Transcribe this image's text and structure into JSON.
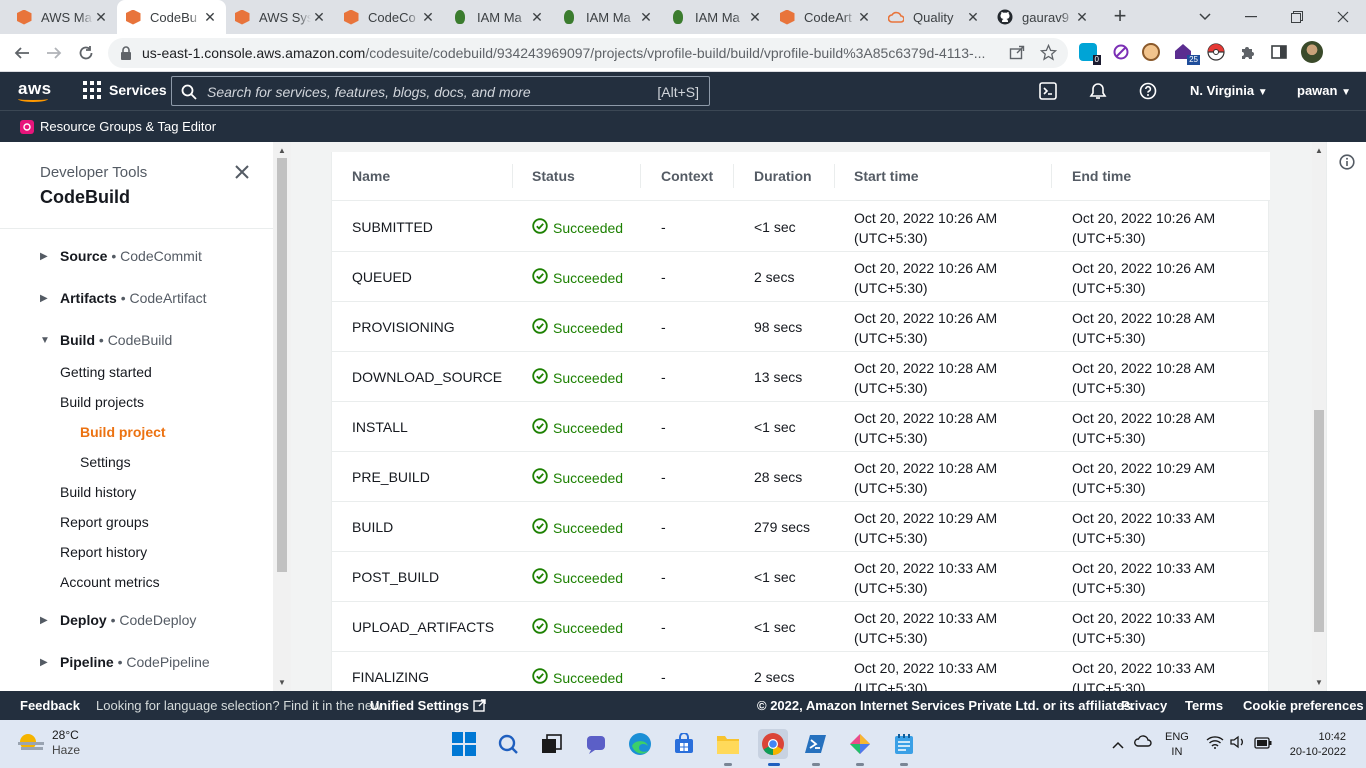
{
  "browser": {
    "tabs": [
      {
        "title": "AWS Ma",
        "icon": "aws-cube-icon",
        "active": false
      },
      {
        "title": "CodeBu",
        "icon": "aws-cube-icon",
        "active": true
      },
      {
        "title": "AWS Sys",
        "icon": "aws-cube-icon",
        "active": false
      },
      {
        "title": "CodeCo",
        "icon": "aws-cube-icon",
        "active": false
      },
      {
        "title": "IAM Ma",
        "icon": "iam-icon",
        "active": false
      },
      {
        "title": "IAM Ma",
        "icon": "iam-icon",
        "active": false
      },
      {
        "title": "IAM Ma",
        "icon": "iam-icon",
        "active": false
      },
      {
        "title": "CodeArt",
        "icon": "aws-cube-icon",
        "active": false
      },
      {
        "title": "Quality",
        "icon": "quality-icon",
        "active": false
      },
      {
        "title": "gaurav9",
        "icon": "github-icon",
        "active": false
      }
    ],
    "url_main": "us-east-1.console.aws.amazon.com",
    "url_path": "/codesuite/codebuild/934243969097/projects/vprofile-build/build/vprofile-build%3A85c6379d-4113-...",
    "ext_badges": {
      "first": "0",
      "second": "25"
    }
  },
  "aws_nav": {
    "logo": "aws",
    "services_label": "Services",
    "search_placeholder": "Search for services, features, blogs, docs, and more",
    "search_shortcut": "[Alt+S]",
    "region": "N. Virginia",
    "user": "pawan"
  },
  "favorites": {
    "resource_groups": "Resource Groups & Tag Editor"
  },
  "sidenav": {
    "section": "Developer Tools",
    "title": "CodeBuild",
    "groups": [
      {
        "name": "Source",
        "sub": "CodeCommit",
        "expanded": false
      },
      {
        "name": "Artifacts",
        "sub": "CodeArtifact",
        "expanded": false
      },
      {
        "name": "Build",
        "sub": "CodeBuild",
        "expanded": true
      },
      {
        "name": "Deploy",
        "sub": "CodeDeploy",
        "expanded": false
      },
      {
        "name": "Pipeline",
        "sub": "CodePipeline",
        "expanded": false
      }
    ],
    "build_items": [
      "Getting started",
      "Build projects",
      "Build project",
      "Settings",
      "Build history",
      "Report groups",
      "Report history",
      "Account metrics"
    ],
    "separator": "•"
  },
  "table": {
    "headers": [
      "Name",
      "Status",
      "Context",
      "Duration",
      "Start time",
      "End time"
    ],
    "rows": [
      {
        "name": "SUBMITTED",
        "status": "Succeeded",
        "context": "-",
        "duration": "<1 sec",
        "start": "Oct 20, 2022 10:26 AM",
        "end": "Oct 20, 2022 10:26 AM"
      },
      {
        "name": "QUEUED",
        "status": "Succeeded",
        "context": "-",
        "duration": "2 secs",
        "start": "Oct 20, 2022 10:26 AM",
        "end": "Oct 20, 2022 10:26 AM"
      },
      {
        "name": "PROVISIONING",
        "status": "Succeeded",
        "context": "-",
        "duration": "98 secs",
        "start": "Oct 20, 2022 10:26 AM",
        "end": "Oct 20, 2022 10:28 AM"
      },
      {
        "name": "DOWNLOAD_SOURCE",
        "status": "Succeeded",
        "context": "-",
        "duration": "13 secs",
        "start": "Oct 20, 2022 10:28 AM",
        "end": "Oct 20, 2022 10:28 AM"
      },
      {
        "name": "INSTALL",
        "status": "Succeeded",
        "context": "-",
        "duration": "<1 sec",
        "start": "Oct 20, 2022 10:28 AM",
        "end": "Oct 20, 2022 10:28 AM"
      },
      {
        "name": "PRE_BUILD",
        "status": "Succeeded",
        "context": "-",
        "duration": "28 secs",
        "start": "Oct 20, 2022 10:28 AM",
        "end": "Oct 20, 2022 10:29 AM"
      },
      {
        "name": "BUILD",
        "status": "Succeeded",
        "context": "-",
        "duration": "279 secs",
        "start": "Oct 20, 2022 10:29 AM",
        "end": "Oct 20, 2022 10:33 AM"
      },
      {
        "name": "POST_BUILD",
        "status": "Succeeded",
        "context": "-",
        "duration": "<1 sec",
        "start": "Oct 20, 2022 10:33 AM",
        "end": "Oct 20, 2022 10:33 AM"
      },
      {
        "name": "UPLOAD_ARTIFACTS",
        "status": "Succeeded",
        "context": "-",
        "duration": "<1 sec",
        "start": "Oct 20, 2022 10:33 AM",
        "end": "Oct 20, 2022 10:33 AM"
      },
      {
        "name": "FINALIZING",
        "status": "Succeeded",
        "context": "-",
        "duration": "2 secs",
        "start": "Oct 20, 2022 10:33 AM",
        "end": "Oct 20, 2022 10:33 AM"
      }
    ],
    "timezone": "(UTC+5:30)"
  },
  "footer": {
    "feedback": "Feedback",
    "language_note": "Looking for language selection? Find it in the new",
    "unified_settings": "Unified Settings",
    "copyright": "© 2022, Amazon Internet Services Private Ltd. or its affiliates.",
    "privacy": "Privacy",
    "terms": "Terms",
    "cookie": "Cookie preferences"
  },
  "taskbar": {
    "temperature": "28°C",
    "weather": "Haze",
    "lang_top": "ENG",
    "lang_bottom": "IN",
    "time": "10:42",
    "date": "20-10-2022"
  },
  "colors": {
    "aws_nav": "#232f3e",
    "accent": "#ec7211",
    "success": "#1d8102"
  }
}
